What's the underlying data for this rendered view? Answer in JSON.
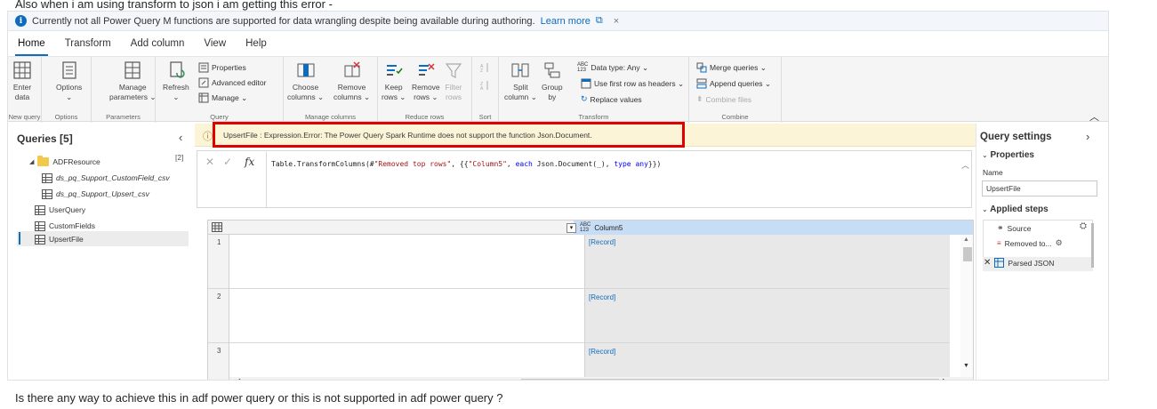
{
  "post": {
    "top_text": "Also when i am using transform to json i am getting this error -",
    "bottom_text": "Is there any way to achieve this in adf power query or this is not supported in adf power query ?"
  },
  "banner": {
    "text": "Currently not all Power Query M functions are supported for data wrangling despite being available during authoring.",
    "link": "Learn more",
    "close": "×"
  },
  "tabs": [
    "Home",
    "Transform",
    "Add column",
    "View",
    "Help"
  ],
  "ribbon": {
    "new_query": {
      "button": [
        "Enter",
        "data"
      ],
      "label": "New query"
    },
    "options": {
      "button": [
        "Options",
        "⌄"
      ],
      "label": "Options"
    },
    "parameters": {
      "button": [
        "Manage",
        "parameters ⌄"
      ],
      "label": "Parameters"
    },
    "query": {
      "refresh": [
        "Refresh",
        "⌄"
      ],
      "properties": "Properties",
      "advanced_editor": "Advanced editor",
      "manage": "Manage ⌄",
      "label": "Query"
    },
    "manage_columns": {
      "choose": [
        "Choose",
        "columns ⌄"
      ],
      "remove": [
        "Remove",
        "columns ⌄"
      ],
      "label": "Manage columns"
    },
    "reduce_rows": {
      "keep": [
        "Keep",
        "rows ⌄"
      ],
      "remove": [
        "Remove",
        "rows ⌄"
      ],
      "filter": [
        "Filter",
        "rows"
      ],
      "label": "Reduce rows"
    },
    "sort": {
      "label": "Sort"
    },
    "transform": {
      "split": [
        "Split",
        "column ⌄"
      ],
      "group": [
        "Group",
        "by"
      ],
      "data_type": "Data type: Any ⌄",
      "first_row": "Use first row as headers ⌄",
      "replace": "Replace values",
      "label": "Transform"
    },
    "combine": {
      "merge": "Merge queries ⌄",
      "append": "Append queries ⌄",
      "combine_files": "Combine files",
      "label": "Combine"
    }
  },
  "queries": {
    "title": "Queries [5]",
    "folder": {
      "name": "ADFResource",
      "count": "[2]"
    },
    "items": [
      "ds_pq_Support_CustomField_csv",
      "ds_pq_Support_Upsert_csv",
      "UserQuery",
      "CustomFields",
      "UpsertFile"
    ]
  },
  "error": {
    "message": "UpsertFile : Expression.Error: The Power Query Spark Runtime does not support the function Json.Document."
  },
  "formula": {
    "fx": "fx",
    "p1": "Table.TransformColumns(#",
    "s1": "\"Removed top rows\"",
    "p2": ", {{",
    "s2": "\"Column5\"",
    "p3": ", ",
    "k1": "each",
    "p4": " Json.Document(_), ",
    "k2": "type",
    "p5": " ",
    "k3": "any",
    "p6": "}})"
  },
  "grid": {
    "column_header": "Column5",
    "type_badge_top": "ABC",
    "type_badge_bottom": "123",
    "rows": [
      {
        "num": "1",
        "value": "[Record]"
      },
      {
        "num": "2",
        "value": "[Record]"
      },
      {
        "num": "3",
        "value": "[Record]"
      }
    ]
  },
  "query_settings": {
    "title": "Query settings",
    "properties_heading": "Properties",
    "name_label": "Name",
    "name_value": "UpsertFile",
    "applied_steps_heading": "Applied steps",
    "steps": [
      "Source",
      "Removed to...",
      "Parsed JSON"
    ]
  },
  "colors": {
    "accent": "#0f6cbd",
    "error_border": "#e00000",
    "error_bg": "#fcf4d6",
    "column_header_bg": "#c7dcf5"
  }
}
